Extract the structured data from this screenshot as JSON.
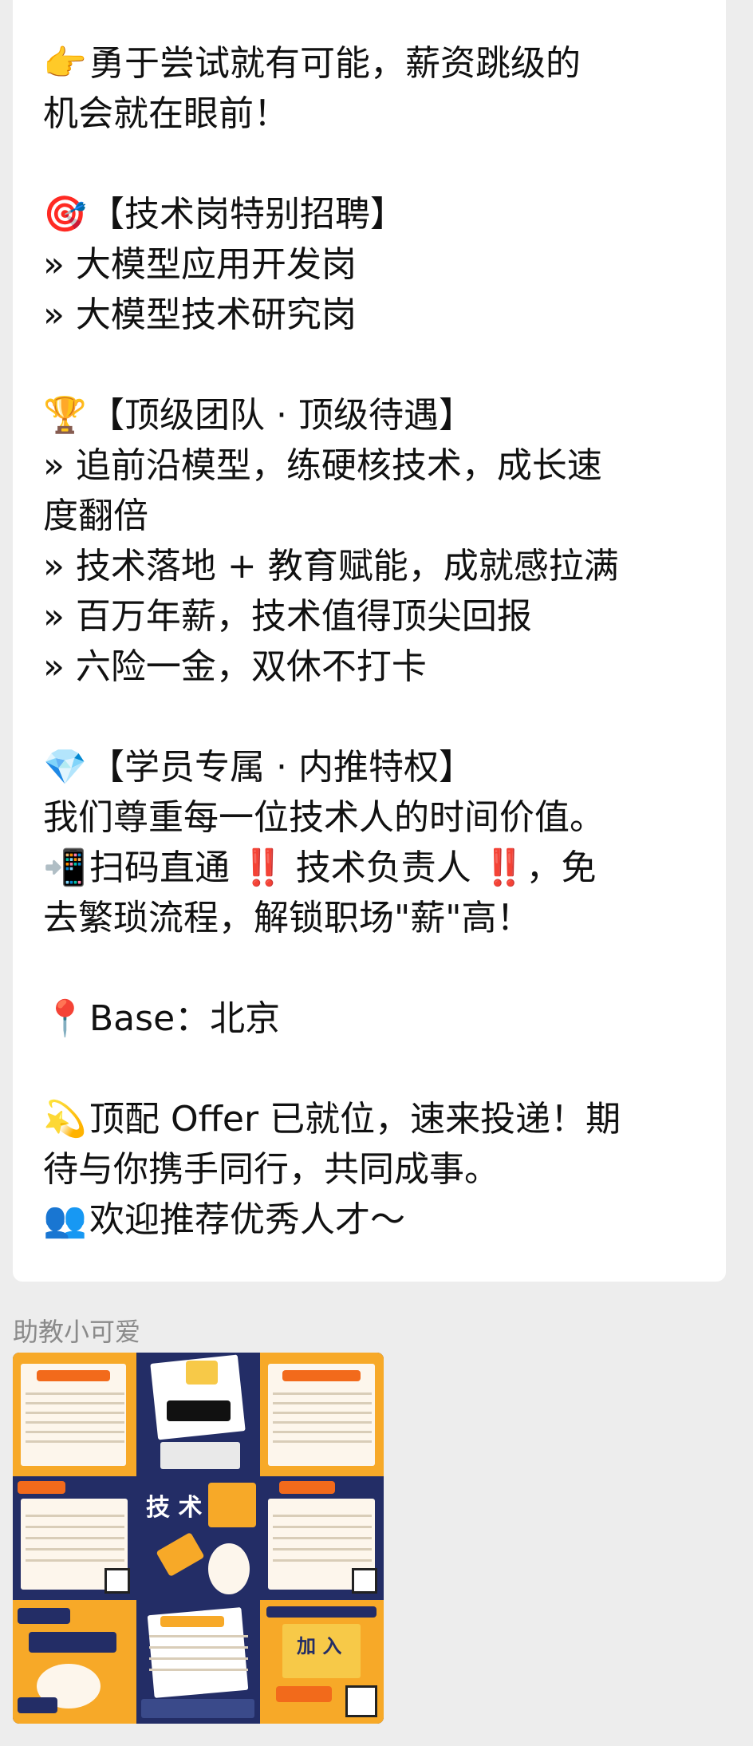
{
  "message": {
    "lines": [
      {
        "emoji": "👉",
        "text": "勇于尝试就有可能，薪资跳级的"
      },
      {
        "emoji": "",
        "text": "机会就在眼前！"
      },
      {
        "emoji": "",
        "text": ""
      },
      {
        "emoji": "🎯",
        "text": "【技术岗特别招聘】"
      },
      {
        "emoji": "",
        "text": "» 大模型应用开发岗"
      },
      {
        "emoji": "",
        "text": "» 大模型技术研究岗"
      },
      {
        "emoji": "",
        "text": ""
      },
      {
        "emoji": "🏆",
        "text": "【顶级团队 · 顶级待遇】"
      },
      {
        "emoji": "",
        "text": "» 追前沿模型，练硬核技术，成长速"
      },
      {
        "emoji": "",
        "text": "度翻倍"
      },
      {
        "emoji": "",
        "text": "» 技术落地 + 教育赋能，成就感拉满"
      },
      {
        "emoji": "",
        "text": "» 百万年薪，技术值得顶尖回报"
      },
      {
        "emoji": "",
        "text": "» 六险一金，双休不打卡"
      },
      {
        "emoji": "",
        "text": ""
      },
      {
        "emoji": "💎",
        "text": "【学员专属 · 内推特权】"
      },
      {
        "emoji": "",
        "text": "我们尊重每一位技术人的时间价值。"
      },
      {
        "emoji": "📲",
        "text": "扫码直通 ‼️ 技术负责人 ‼️，免"
      },
      {
        "emoji": "",
        "text": "去繁琐流程，解锁职场\"薪\"高！"
      },
      {
        "emoji": "",
        "text": ""
      },
      {
        "emoji": "📍",
        "text": "Base：北京"
      },
      {
        "emoji": "",
        "text": ""
      },
      {
        "emoji": "💫",
        "text": "顶配 Offer 已就位，速来投递！期"
      },
      {
        "emoji": "",
        "text": "待与你携手同行，共同成事。"
      },
      {
        "emoji": "👥",
        "text": "欢迎推荐优秀人才～"
      }
    ]
  },
  "sender": {
    "name": "助教小可爱"
  },
  "image": {
    "tiles": [
      {
        "theme": "orange"
      },
      {
        "theme": "navy"
      },
      {
        "theme": "orange"
      },
      {
        "theme": "navy"
      },
      {
        "theme": "orange"
      },
      {
        "theme": "navy"
      },
      {
        "theme": "orange"
      },
      {
        "theme": "navy"
      },
      {
        "theme": "orange"
      }
    ],
    "colors": {
      "orange": "#f7a928",
      "navy": "#232d66",
      "accent": "#f26a1b"
    }
  }
}
